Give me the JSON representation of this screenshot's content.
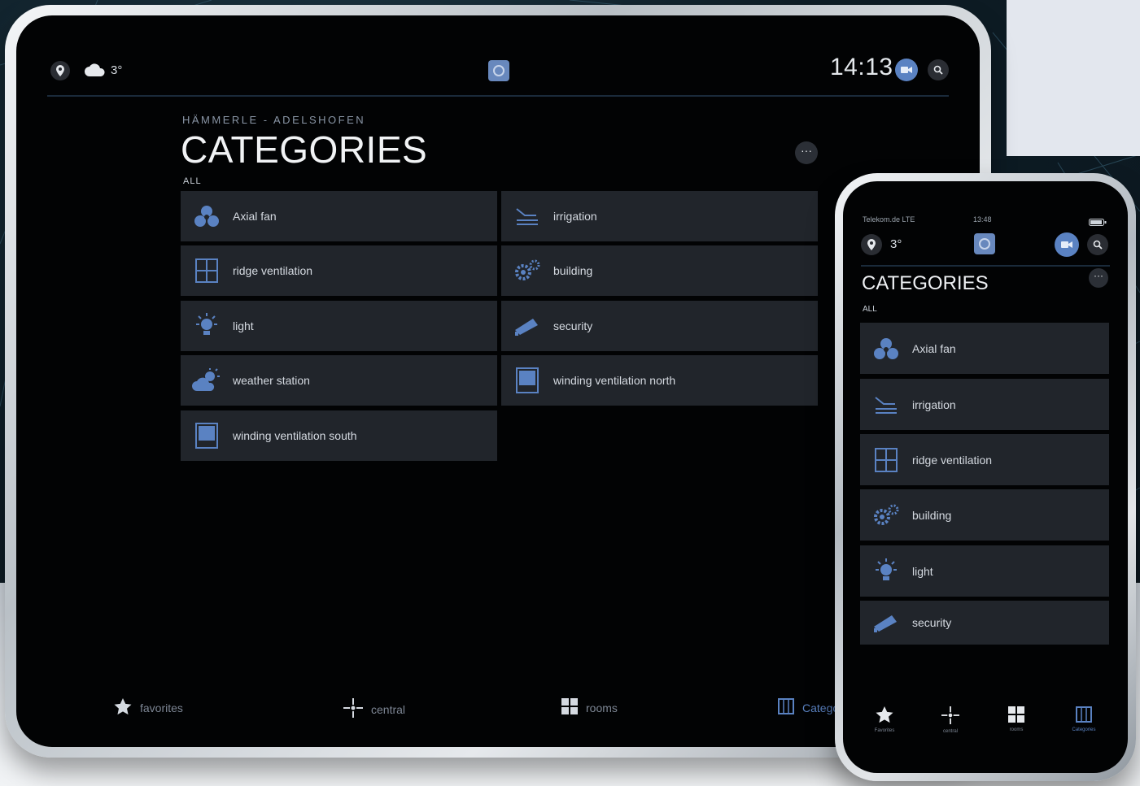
{
  "colors": {
    "accent": "#5a82c2",
    "card": "#21252b",
    "screen": "#020304"
  },
  "tablet": {
    "weather_temp": "3°",
    "clock": "14:13",
    "location": "HÄMMERLE - ADELSHOFEN",
    "title": "CATEGORIES",
    "filter": "ALL",
    "more": "···",
    "categories": [
      {
        "label": "Axial fan",
        "icon": "fan-icon"
      },
      {
        "label": "irrigation",
        "icon": "irrigation-icon"
      },
      {
        "label": "ridge ventilation",
        "icon": "window-icon"
      },
      {
        "label": "building",
        "icon": "gears-icon"
      },
      {
        "label": "light",
        "icon": "bulb-icon"
      },
      {
        "label": "security",
        "icon": "camera-icon"
      },
      {
        "label": "weather station",
        "icon": "weather-icon"
      },
      {
        "label": "winding ventilation north",
        "icon": "blind-icon"
      },
      {
        "label": "winding ventilation south",
        "icon": "blind-icon"
      }
    ],
    "nav": [
      {
        "label": "favorites",
        "icon": "star-icon"
      },
      {
        "label": "central",
        "icon": "central-icon"
      },
      {
        "label": "rooms",
        "icon": "rooms-icon"
      },
      {
        "label": "Catego",
        "icon": "categories-icon",
        "active": true
      }
    ]
  },
  "phone": {
    "status_carrier": "Telekom.de LTE",
    "status_time": "13:48",
    "weather_temp": "3°",
    "title": "CATEGORIES",
    "filter": "ALL",
    "more": "···",
    "categories": [
      {
        "label": "Axial fan",
        "icon": "fan-icon"
      },
      {
        "label": "irrigation",
        "icon": "irrigation-icon"
      },
      {
        "label": "ridge ventilation",
        "icon": "window-icon"
      },
      {
        "label": "building",
        "icon": "gears-icon"
      },
      {
        "label": "light",
        "icon": "bulb-icon"
      },
      {
        "label": "security",
        "icon": "camera-icon"
      }
    ],
    "nav": [
      {
        "label": "Favorites",
        "icon": "star-icon"
      },
      {
        "label": "central",
        "icon": "central-icon"
      },
      {
        "label": "rooms",
        "icon": "rooms-icon"
      },
      {
        "label": "Categories",
        "icon": "categories-icon",
        "active": true
      }
    ]
  }
}
